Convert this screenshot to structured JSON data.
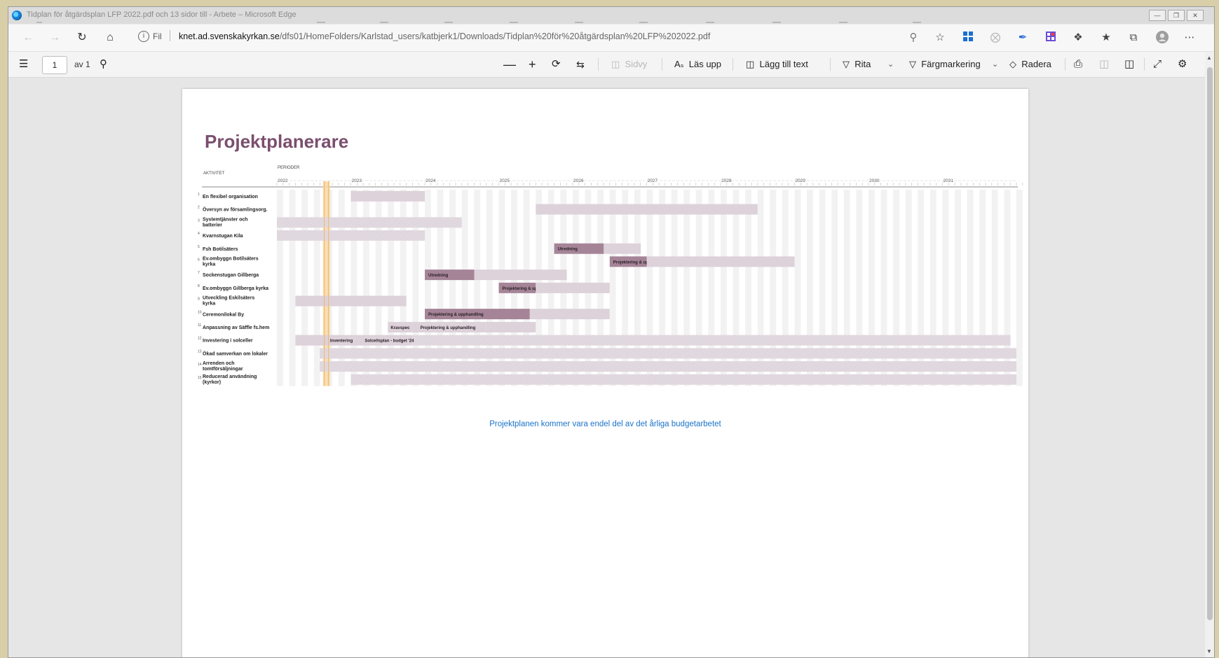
{
  "window": {
    "title": "Tidplan för åtgärdsplan LFP 2022.pdf och 13 sidor till - Arbete – Microsoft Edge"
  },
  "address": {
    "protocol_label": "Fil",
    "host": "knet.ad.svenskakyrkan.se",
    "path": "/dfs01/HomeFolders/Karlstad_users/katbjerk1/Downloads/Tidplan%20för%20åtgärdsplan%20LFP%202022.pdf"
  },
  "pdf_toolbar": {
    "page_number": "1",
    "page_of": "av 1",
    "sidvy": "Sidvy",
    "las_upp": "Läs upp",
    "lagg_till_text": "Lägg till text",
    "rita": "Rita",
    "fargmarkering": "Färgmarkering",
    "radera": "Radera"
  },
  "document": {
    "title": "Projektplanerare",
    "col_activity": "AKTIVITET",
    "col_periods": "PERIODER",
    "years": [
      "2022",
      "2023",
      "2024",
      "2025",
      "2026",
      "2027",
      "2028",
      "2029",
      "2030",
      "2031"
    ],
    "activities": [
      {
        "num": "1",
        "name": "En flexibel organisation",
        "bars": [
          {
            "start": 2023.0,
            "end": 2024.0
          }
        ],
        "labels": []
      },
      {
        "num": "2",
        "name": "Översyn av församlingsorg.",
        "bars": [
          {
            "start": 2025.5,
            "end": 2028.5
          }
        ],
        "labels": []
      },
      {
        "num": "3",
        "name": "Systemtjänster och batterier",
        "bars": [
          {
            "start": 2022.0,
            "end": 2024.5
          }
        ],
        "labels": []
      },
      {
        "num": "4",
        "name": "Kvarnstugan Kila",
        "bars": [
          {
            "start": 2022.0,
            "end": 2024.0
          }
        ],
        "labels": []
      },
      {
        "num": "5",
        "name": "Fsh Botilsäters",
        "bars": [
          {
            "start": 2025.75,
            "end": 2026.42,
            "label": "Utredning"
          },
          {
            "start": 2026.42,
            "end": 2026.92
          }
        ],
        "labels": []
      },
      {
        "num": "6",
        "name": "Ev.ombyggn Botilsäters kyrka",
        "bars": [
          {
            "start": 2026.5,
            "end": 2027.0,
            "label": "Projektering & upphandling"
          },
          {
            "start": 2027.0,
            "end": 2029.0
          }
        ],
        "labels": []
      },
      {
        "num": "7",
        "name": "Sockenstugan Gillberga",
        "bars": [
          {
            "start": 2024.0,
            "end": 2024.67,
            "label": "Utredning"
          },
          {
            "start": 2024.67,
            "end": 2025.92
          }
        ],
        "labels": []
      },
      {
        "num": "8",
        "name": "Ev.ombyggn Gillberga kyrka",
        "bars": [
          {
            "start": 2025.0,
            "end": 2025.5,
            "label": "Projektering & upphandling"
          },
          {
            "start": 2025.5,
            "end": 2026.5
          }
        ],
        "labels": []
      },
      {
        "num": "9",
        "name": "Utveckling Eskilsäters kyrka",
        "bars": [
          {
            "start": 2022.25,
            "end": 2023.75
          }
        ],
        "labels": []
      },
      {
        "num": "10",
        "name": "Ceremonilokal By",
        "bars": [
          {
            "start": 2024.0,
            "end": 2025.42,
            "label": "Projektering & upphandling"
          },
          {
            "start": 2025.42,
            "end": 2026.5
          }
        ],
        "labels": []
      },
      {
        "num": "11",
        "name": "Anpassning av Säffle fs.hem",
        "bars": [
          {
            "start": 2023.5,
            "end": 2023.83
          },
          {
            "start": 2023.83,
            "end": 2024.83
          },
          {
            "start": 2024.83,
            "end": 2025.5
          }
        ],
        "labels": [
          {
            "year": 2023.52,
            "text": "Kravspec"
          },
          {
            "year": 2023.92,
            "text": "Projektering & upphandling"
          }
        ]
      },
      {
        "num": "12",
        "name": "Investering i solceller",
        "bars": [
          {
            "start": 2022.25,
            "end": 2023.17
          },
          {
            "start": 2023.17,
            "end": 2023.83
          },
          {
            "start": 2023.83,
            "end": 2031.92
          }
        ],
        "labels": [
          {
            "year": 2022.7,
            "text": "Inventering"
          },
          {
            "year": 2023.17,
            "text": "Solcellsplan - budget '24"
          }
        ]
      },
      {
        "num": "13",
        "name": "Ökad samverkan om lokaler",
        "bars": [
          {
            "start": 2022.58,
            "end": 2032.0
          }
        ],
        "labels": []
      },
      {
        "num": "14",
        "name": "Arrenden och tomtförsäljningar",
        "bars": [
          {
            "start": 2022.58,
            "end": 2032.0
          }
        ],
        "labels": []
      },
      {
        "num": "15",
        "name": "Reducerad användning (kyrkor)",
        "bars": [
          {
            "start": 2023.0,
            "end": 2032.0
          }
        ],
        "labels": []
      }
    ],
    "current_period": 2022.67,
    "footer_note": "Projektplanen kommer vara endel del av det årliga budgetarbetet"
  },
  "colors": {
    "title": "#7a4f6f",
    "bar_light": "#ddd1da",
    "bar_dark": "#a58498",
    "bar_hatched": "#e3dbe2",
    "current_period": "#f4b562",
    "link": "#1a73c8"
  }
}
